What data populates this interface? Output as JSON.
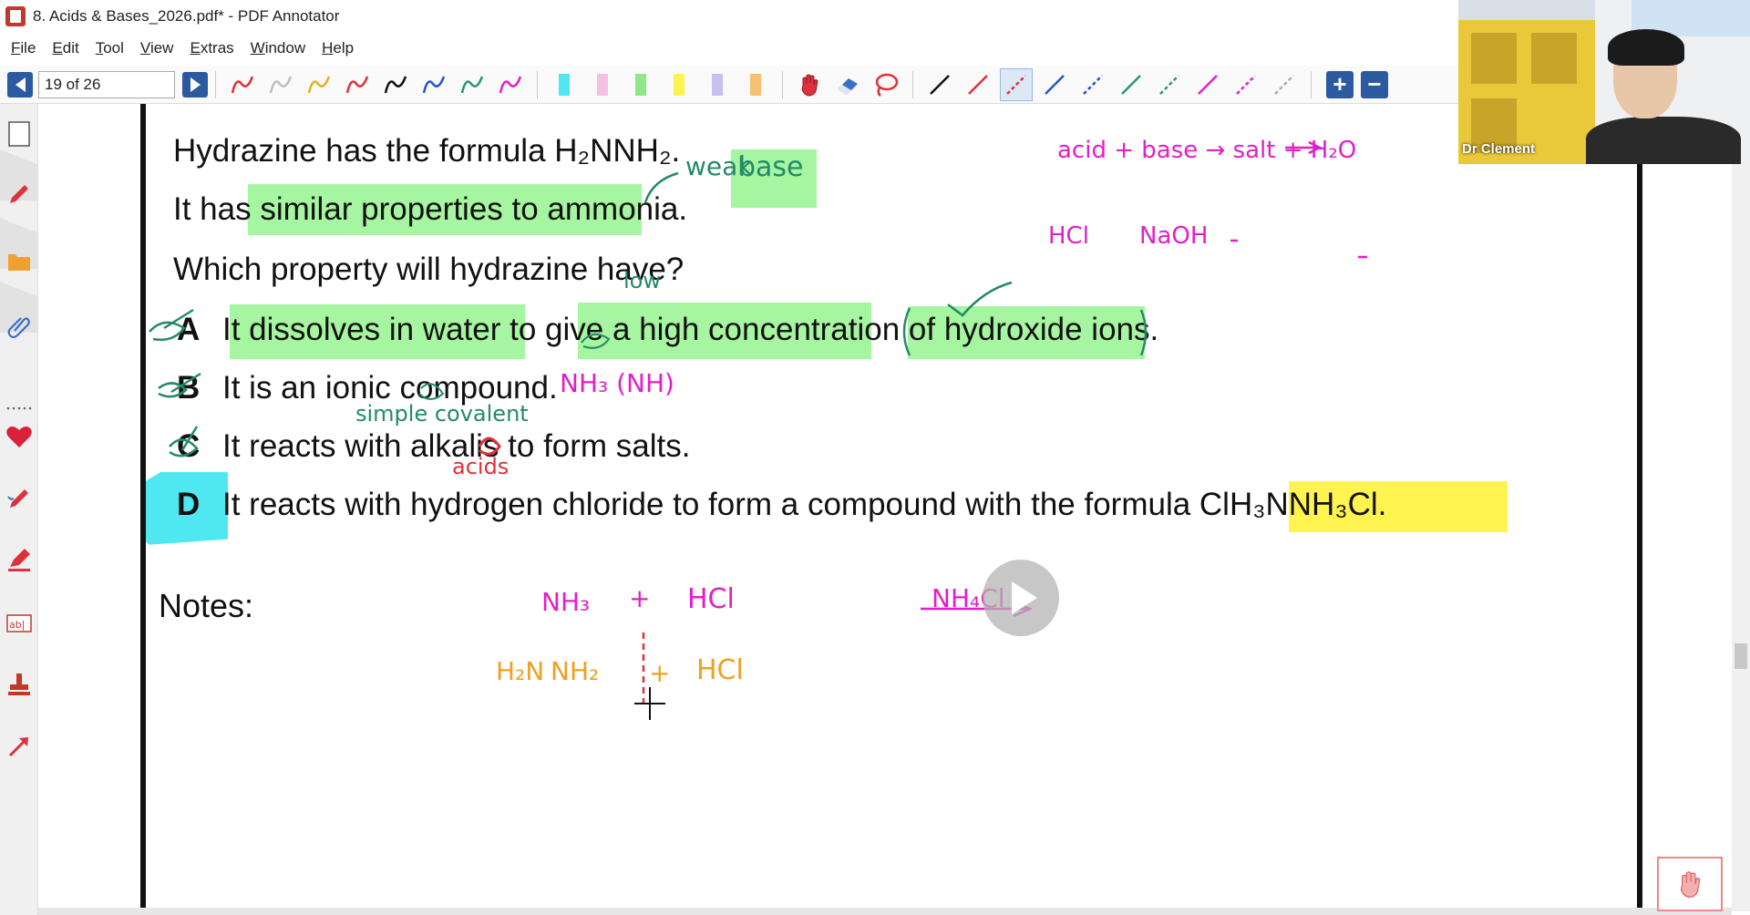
{
  "window": {
    "title": "8. Acids & Bases_2026.pdf* - PDF Annotator"
  },
  "menu": [
    "File",
    "Edit",
    "Tool",
    "View",
    "Extras",
    "Window",
    "Help"
  ],
  "toolbar": {
    "page_indicator": "19 of 26",
    "pen_colors": [
      "#e0303b",
      "#bfbfbf",
      "#e8b020",
      "#e0303b",
      "#111111",
      "#2255cc",
      "#2a9a6a",
      "#e020c8"
    ],
    "highlighter_colors": [
      "#4fe8f0",
      "#f4c0e4",
      "#8ee88a",
      "#fff44f",
      "#c8c0f0",
      "#f8c070"
    ],
    "line_colors": [
      "#111111",
      "#e0303b",
      "#e0303b",
      "#2255cc",
      "#2255cc",
      "#2a9a6a",
      "#2a9a6a",
      "#e020c8",
      "#e020c8",
      "#aaaaaa"
    ],
    "zoom_in_icon": "plus-icon",
    "zoom_out_icon": "minus-icon"
  },
  "document": {
    "question_lines": [
      "Hydrazine has the formula H₂NNH₂.",
      "It has similar properties to ammonia.",
      "Which property will hydrazine have?"
    ],
    "options": [
      {
        "letter": "A",
        "text": "It dissolves in water to give a high concentration of hydroxide ions."
      },
      {
        "letter": "B",
        "text": "It is an ionic compound."
      },
      {
        "letter": "C",
        "text": "It reacts with alkalis to form salts."
      },
      {
        "letter": "D",
        "text": "It reacts with hydrogen chloride to form a compound with the formula ClH₃NNH₃Cl."
      }
    ],
    "notes_label": "Notes:"
  },
  "annotations": {
    "weak_base": [
      "weak",
      "base"
    ],
    "low": "low",
    "nh3_nh": "NH₃  (NH)",
    "simple_covalent": "simple  covalent",
    "acids": "acids",
    "acid_base_eq": "acid + base → salt + H₂O",
    "hcl_naoh": [
      "HCl",
      "NaOH"
    ],
    "nh3_hcl_eq": [
      "NH₃",
      "+",
      "HCl",
      "NH₄Cl"
    ],
    "hydrazine_hcl": [
      "H₂N",
      "NH₂",
      "+",
      "HCl"
    ]
  },
  "webcam": {
    "name_label": "Dr Clement"
  }
}
